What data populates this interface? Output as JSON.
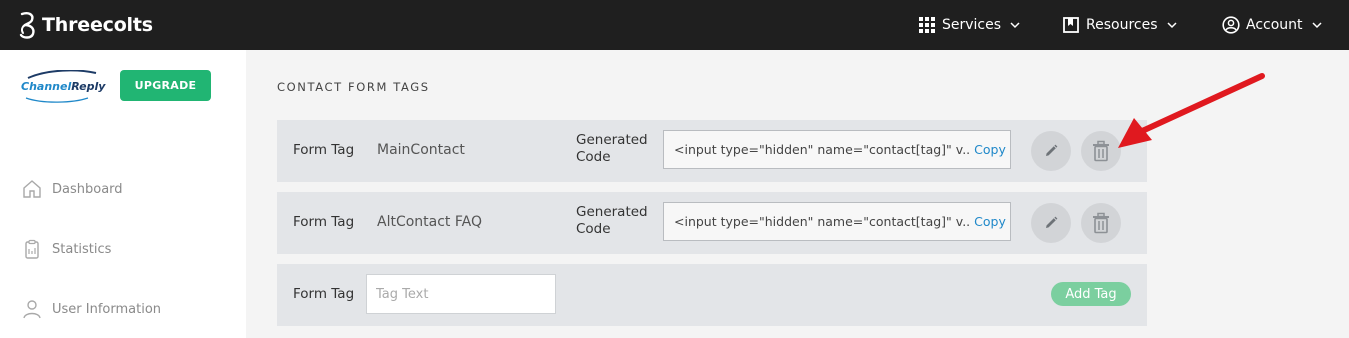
{
  "header": {
    "brand_name": "Threecolts",
    "nav": {
      "services_label": "Services",
      "resources_label": "Resources",
      "account_label": "Account"
    }
  },
  "sidebar": {
    "logo": {
      "part1": "Channel",
      "part2": "Reply"
    },
    "upgrade_label": "UPGRADE",
    "items": [
      {
        "label": "Dashboard",
        "icon": "home-icon"
      },
      {
        "label": "Statistics",
        "icon": "clipboard-icon"
      },
      {
        "label": "User Information",
        "icon": "user-icon"
      }
    ]
  },
  "main": {
    "section_title": "CONTACT FORM TAGS",
    "rows": [
      {
        "form_tag_label": "Form Tag",
        "tag_value": "MainContact",
        "generated_code_label": "Generated Code",
        "code_value": "<input type=\"hidden\" name=\"contact[tag]\" v..",
        "copy_label": "Copy"
      },
      {
        "form_tag_label": "Form Tag",
        "tag_value": "AltContact FAQ",
        "generated_code_label": "Generated Code",
        "code_value": "<input type=\"hidden\" name=\"contact[tag]\" v..",
        "copy_label": "Copy"
      }
    ],
    "new_tag": {
      "form_tag_label": "Form Tag",
      "placeholder": "Tag Text",
      "add_label": "Add Tag"
    }
  },
  "colors": {
    "topbar": "#1f1f1f",
    "accent_green": "#21b573",
    "add_tag_green": "#7bcf9f",
    "link_blue": "#1f88c9",
    "annotation_red": "#e0191f"
  }
}
